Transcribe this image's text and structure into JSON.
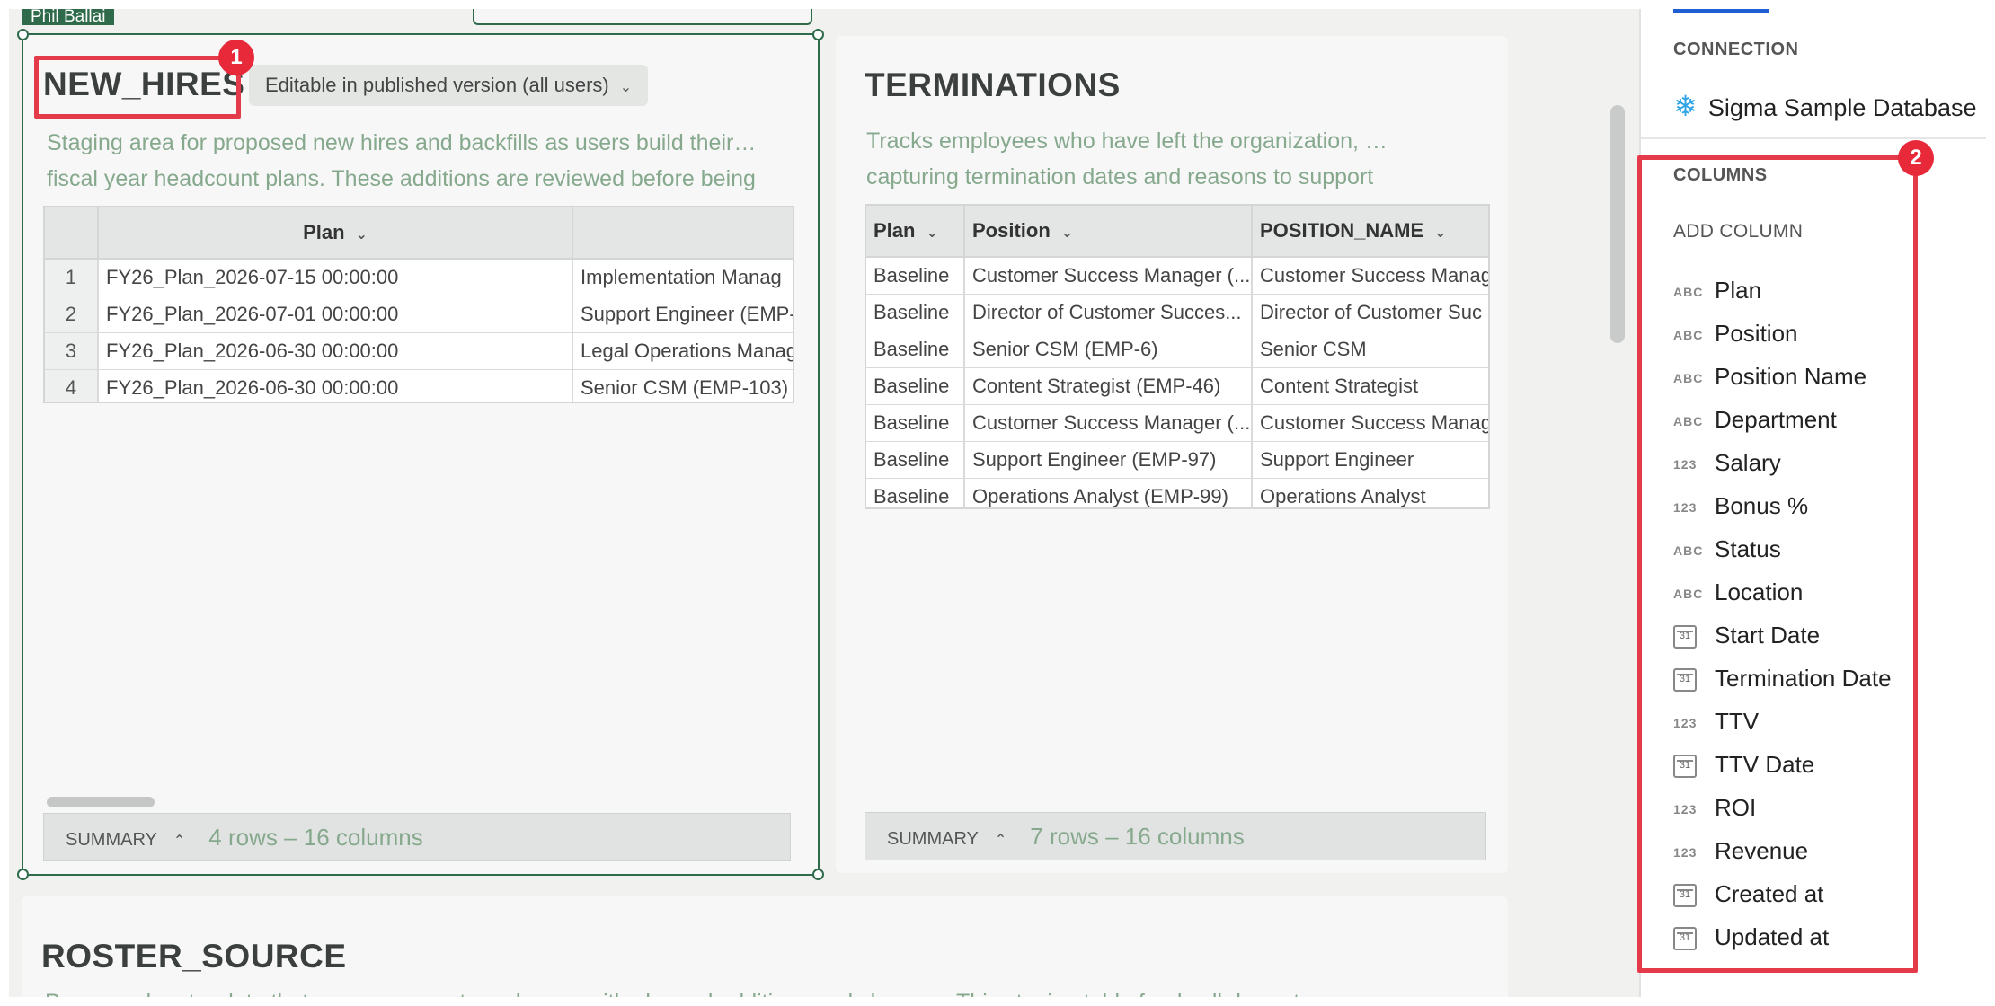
{
  "user_tag": "Phil Ballai",
  "new_hires": {
    "title": "NEW_HIRES",
    "edit_pill": "Editable in published version (all users)",
    "desc_line1": "Staging area for proposed new hires and backfills as users build their…",
    "desc_line2": "fiscal year headcount plans. These additions are reviewed before being",
    "headers": [
      "",
      "Plan",
      ""
    ],
    "rows": [
      {
        "idx": "1",
        "plan": "FY26_Plan_2026-07-15 00:00:00",
        "position": "Implementation Manag"
      },
      {
        "idx": "2",
        "plan": "FY26_Plan_2026-07-01 00:00:00",
        "position": "Support Engineer (EMP-"
      },
      {
        "idx": "3",
        "plan": "FY26_Plan_2026-06-30 00:00:00",
        "position": "Legal Operations Manag"
      },
      {
        "idx": "4",
        "plan": "FY26_Plan_2026-06-30 00:00:00",
        "position": "Senior CSM (EMP-103)"
      }
    ],
    "summary_label": "SUMMARY",
    "summary_rows": "4 rows – 16 columns"
  },
  "terminations": {
    "title": "TERMINATIONS",
    "desc_line1": "Tracks employees who have left the organization, …",
    "desc_line2": "capturing termination dates and reasons to support",
    "headers": [
      "Plan",
      "Position",
      "POSITION_NAME"
    ],
    "rows": [
      {
        "plan": "Baseline",
        "position": "Customer Success Manager (...",
        "name": "Customer Success Manag"
      },
      {
        "plan": "Baseline",
        "position": "Director of Customer Succes...",
        "name": "Director of Customer Suc"
      },
      {
        "plan": "Baseline",
        "position": "Senior CSM (EMP-6)",
        "name": "Senior CSM"
      },
      {
        "plan": "Baseline",
        "position": "Content Strategist (EMP-46)",
        "name": "Content Strategist"
      },
      {
        "plan": "Baseline",
        "position": "Customer Success Manager (...",
        "name": "Customer Success Manag"
      },
      {
        "plan": "Baseline",
        "position": "Support Engineer (EMP-97)",
        "name": "Support Engineer"
      },
      {
        "plan": "Baseline",
        "position": "Operations Analyst (EMP-99)",
        "name": "Operations Analyst"
      }
    ],
    "summary_label": "SUMMARY",
    "summary_rows": "7 rows – 16 columns"
  },
  "roster": {
    "title": "ROSTER_SOURCE",
    "desc": "Processed roster data that merges current employees with planned additions and changes. This staging table feeds all downstream"
  },
  "sidebar": {
    "connection_label": "CONNECTION",
    "connection_name": "Sigma Sample Database",
    "columns_label": "COLUMNS",
    "add_column": "ADD COLUMN",
    "columns": [
      {
        "type": "ABC",
        "name": "Plan"
      },
      {
        "type": "ABC",
        "name": "Position"
      },
      {
        "type": "ABC",
        "name": "Position Name"
      },
      {
        "type": "ABC",
        "name": "Department"
      },
      {
        "type": "123",
        "name": "Salary"
      },
      {
        "type": "123",
        "name": "Bonus %"
      },
      {
        "type": "ABC",
        "name": "Status"
      },
      {
        "type": "ABC",
        "name": "Location"
      },
      {
        "type": "date",
        "name": "Start Date"
      },
      {
        "type": "date",
        "name": "Termination Date"
      },
      {
        "type": "123",
        "name": "TTV"
      },
      {
        "type": "date",
        "name": "TTV Date"
      },
      {
        "type": "123",
        "name": "ROI"
      },
      {
        "type": "123",
        "name": "Revenue"
      },
      {
        "type": "date",
        "name": "Created at"
      },
      {
        "type": "date",
        "name": "Updated at"
      }
    ]
  },
  "annotations": [
    "1",
    "2"
  ],
  "colors": {
    "accent": "#2f6b4b",
    "annotation": "#e43b4b",
    "desc_text": "#86a98e"
  }
}
